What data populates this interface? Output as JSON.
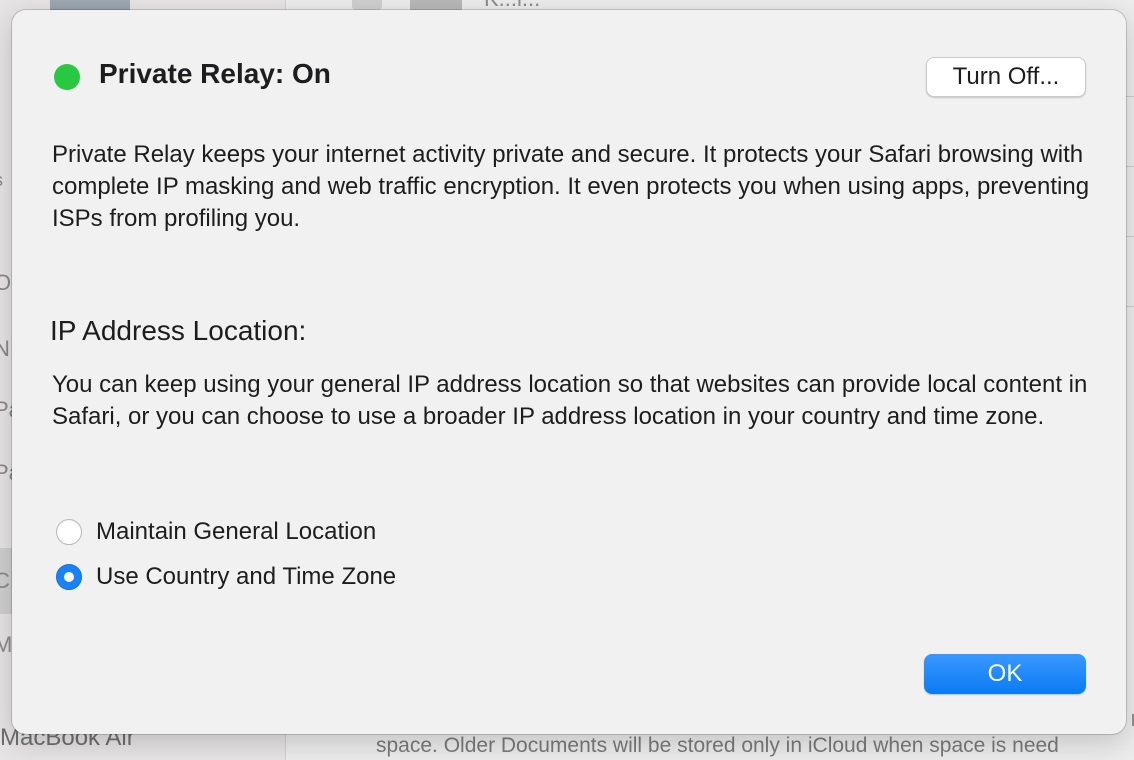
{
  "background": {
    "sidebar_letters": [
      "s",
      "O",
      "N",
      "Pa",
      "Pa",
      "C",
      "M"
    ],
    "sidebar_bottom_label": "MacBook Air",
    "top_partial_text": "K...l...",
    "bottom_partial_text": "space. Older Documents will be stored only in iCloud when space is need"
  },
  "dialog": {
    "status_color": "#28c840",
    "title": "Private Relay: On",
    "turn_off_label": "Turn Off...",
    "description": "Private Relay keeps your internet activity private and secure. It protects your Safari browsing with complete IP masking and web traffic encryption. It even protects you when using apps, preventing ISPs from profiling you.",
    "location_heading": "IP Address Location:",
    "location_description": "You can keep using your general IP address location so that websites can provide local content in Safari, or you can choose to use a broader IP address location in your country and time zone.",
    "options": [
      {
        "label": "Maintain General Location",
        "selected": false
      },
      {
        "label": "Use Country and Time Zone",
        "selected": true
      }
    ],
    "ok_label": "OK",
    "accent_color": "#1a82f7"
  }
}
